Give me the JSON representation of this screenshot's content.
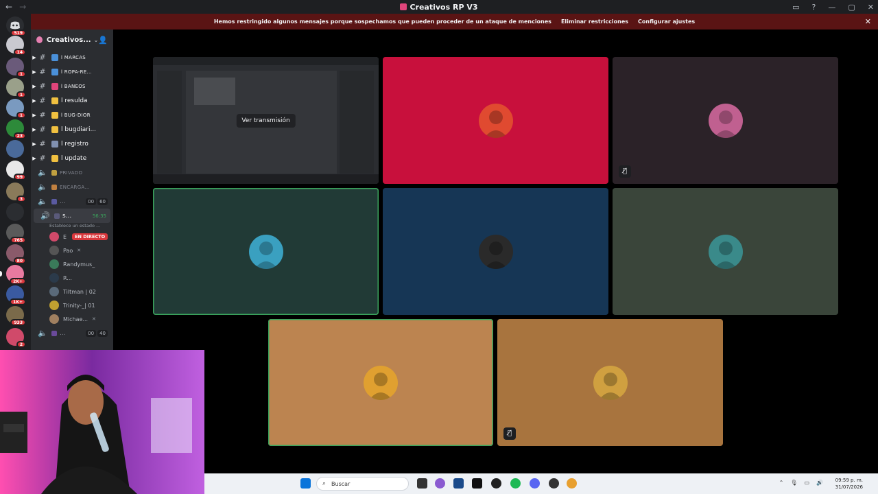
{
  "window": {
    "title": "Creativos RP V3",
    "back_icon": "arrow-left-icon",
    "forward_icon": "arrow-right-icon"
  },
  "banner": {
    "message": "Hemos restringido algunos mensajes porque sospechamos que pueden proceder de un ataque de menciones",
    "remove_label": "Eliminar restricciones",
    "settings_label": "Configurar ajustes",
    "close_glyph": "✕"
  },
  "rail": {
    "home_badge": "519",
    "servers": [
      {
        "badge": "14",
        "color": "#c9c9d0"
      },
      {
        "badge": "1",
        "color": "#6a5a7a"
      },
      {
        "badge": "1",
        "color": "#9aa08a"
      },
      {
        "badge": "1",
        "color": "#7a9ac0"
      },
      {
        "badge": "23",
        "color": "#2d8a3a"
      },
      {
        "badge": "",
        "color": "#4a6a9a"
      },
      {
        "badge": "99",
        "color": "#e8e8e8"
      },
      {
        "badge": "3",
        "color": "#8a7a5a"
      },
      {
        "badge": "",
        "color": "#2b2d31"
      },
      {
        "badge": "765",
        "color": "#5a5a5a"
      },
      {
        "badge": "80",
        "color": "#8a5a6a"
      },
      {
        "badge": "2K+",
        "color": "#e87aa0"
      },
      {
        "badge": "1K+",
        "color": "#3a5aa0"
      },
      {
        "badge": "933",
        "color": "#7a6a4a"
      },
      {
        "badge": "2",
        "color": "#d04a6a"
      }
    ]
  },
  "server": {
    "name": "Creativos...",
    "caret": "⌄",
    "invite_glyph": "👤"
  },
  "channels": [
    {
      "name": "MARCAS",
      "prefix": "l",
      "small": true,
      "color": "#4a90d9"
    },
    {
      "name": "ROPA-RE...",
      "prefix": "l",
      "small": true,
      "color": "#4a90d9"
    },
    {
      "name": "BANEOS",
      "prefix": "l",
      "small": true,
      "color": "#e0457b"
    },
    {
      "name": "resulda",
      "prefix": "l",
      "small": false,
      "color": "#f0c040"
    },
    {
      "name": "BUG-DIOR",
      "prefix": "l",
      "small": true,
      "color": "#f0c040"
    },
    {
      "name": "bugdiari...",
      "prefix": "l",
      "small": false,
      "color": "#f0c040"
    },
    {
      "name": "registro",
      "prefix": "l",
      "small": false,
      "color": "#8090b0"
    },
    {
      "name": "update",
      "prefix": "l",
      "small": false,
      "color": "#f0c040"
    }
  ],
  "voice_channels": {
    "privado": {
      "name": "PRIVADO",
      "prefix": "l"
    },
    "encargado": {
      "name": "ENCARGA...",
      "prefix": "l"
    },
    "vc1": {
      "name": "...",
      "prefix": "l",
      "count_a": "00",
      "count_b": "60"
    },
    "active": {
      "name": "s...",
      "prefix": "l",
      "timer": "56:35",
      "status": "Establece un estado ..."
    },
    "vc2": {
      "name": "...",
      "prefix": "l",
      "count_a": "00",
      "count_b": "40"
    }
  },
  "voice_users": [
    {
      "name": "E",
      "live": "EN DIRECTO",
      "color": "#d04a6a"
    },
    {
      "name": "Pao",
      "live": "",
      "color": "#555"
    },
    {
      "name": "Randymus_",
      "live": "",
      "color": "#3a7a5a"
    },
    {
      "name": "R...",
      "live": "",
      "color": "#2b3a4a"
    },
    {
      "name": "Tiltman | 02",
      "live": "",
      "color": "#5a6a7a"
    },
    {
      "name": "Trinity-_| 01",
      "live": "",
      "color": "#c0a030"
    },
    {
      "name": "Michae...",
      "live": "",
      "color": "#a08060"
    }
  ],
  "stage": {
    "stream_label": "Ver transmisión"
  },
  "tiles": [
    {
      "bg": "#2a2c2e",
      "avatar": "#333",
      "speaking": false,
      "muted": false,
      "stream": true
    },
    {
      "bg": "#c8103c",
      "avatar": "#e04a30",
      "speaking": false,
      "muted": false,
      "stream": false
    },
    {
      "bg": "#2b2228",
      "avatar": "#c06090",
      "speaking": false,
      "muted": true,
      "stream": false
    },
    {
      "bg": "#213a36",
      "avatar": "#3aa0c0",
      "speaking": true,
      "muted": false,
      "stream": false
    },
    {
      "bg": "#163655",
      "avatar": "#2a2a2a",
      "speaking": false,
      "muted": false,
      "stream": false
    },
    {
      "bg": "#3a453a",
      "avatar": "#3a8a8a",
      "speaking": false,
      "muted": false,
      "stream": false
    },
    {
      "bg": "#bc8450",
      "avatar": "#e0a030",
      "speaking": true,
      "muted": false,
      "stream": false
    },
    {
      "bg": "#a8743e",
      "avatar": "#d0a040",
      "speaking": false,
      "muted": true,
      "stream": false
    }
  ],
  "taskbar": {
    "search_placeholder": "Buscar",
    "time": "09:59 p. m.",
    "date": "31/07/2026"
  }
}
